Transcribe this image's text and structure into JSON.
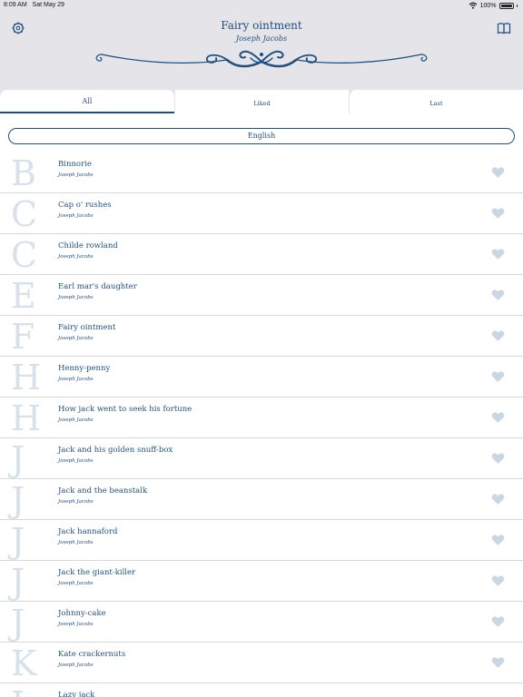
{
  "status": {
    "time": "8:09 AM",
    "date": "Sat May 29",
    "battery": "100%"
  },
  "header": {
    "title": "Fairy ointment",
    "subtitle": "Joseph Jacobs",
    "left_icon": "settings-icon",
    "right_icon": "book-icon"
  },
  "tabs": [
    {
      "label": "All",
      "selected": true
    },
    {
      "label": "Liked",
      "selected": false
    },
    {
      "label": "Last",
      "selected": false
    }
  ],
  "language": "English",
  "colors": {
    "accent": "#1f4f7f",
    "header_bg": "#e5e5e9",
    "letter": "#d7e1ec",
    "heart": "#c9d6e4"
  },
  "stories": [
    {
      "letter": "B",
      "title": "Binnorie",
      "author": "Joseph Jacobs"
    },
    {
      "letter": "C",
      "title": "Cap o' rushes",
      "author": "Joseph Jacobs"
    },
    {
      "letter": "C",
      "title": "Childe rowland",
      "author": "Joseph Jacobs"
    },
    {
      "letter": "E",
      "title": "Earl mar's daughter",
      "author": "Joseph Jacobs"
    },
    {
      "letter": "F",
      "title": "Fairy ointment",
      "author": "Joseph Jacobs"
    },
    {
      "letter": "H",
      "title": "Henny-penny",
      "author": "Joseph Jacobs"
    },
    {
      "letter": "H",
      "title": "How jack went to seek his fortune",
      "author": "Joseph Jacobs"
    },
    {
      "letter": "J",
      "title": "Jack and his golden snuff-box",
      "author": "Joseph Jacobs"
    },
    {
      "letter": "J",
      "title": "Jack and the beanstalk",
      "author": "Joseph Jacobs"
    },
    {
      "letter": "J",
      "title": "Jack hannaford",
      "author": "Joseph Jacobs"
    },
    {
      "letter": "J",
      "title": "Jack the giant-killer",
      "author": "Joseph Jacobs"
    },
    {
      "letter": "J",
      "title": "Johnny-cake",
      "author": "Joseph Jacobs"
    },
    {
      "letter": "K",
      "title": "Kate crackernuts",
      "author": "Joseph Jacobs"
    },
    {
      "letter": "L",
      "title": "Lazy jack",
      "author": ""
    }
  ]
}
